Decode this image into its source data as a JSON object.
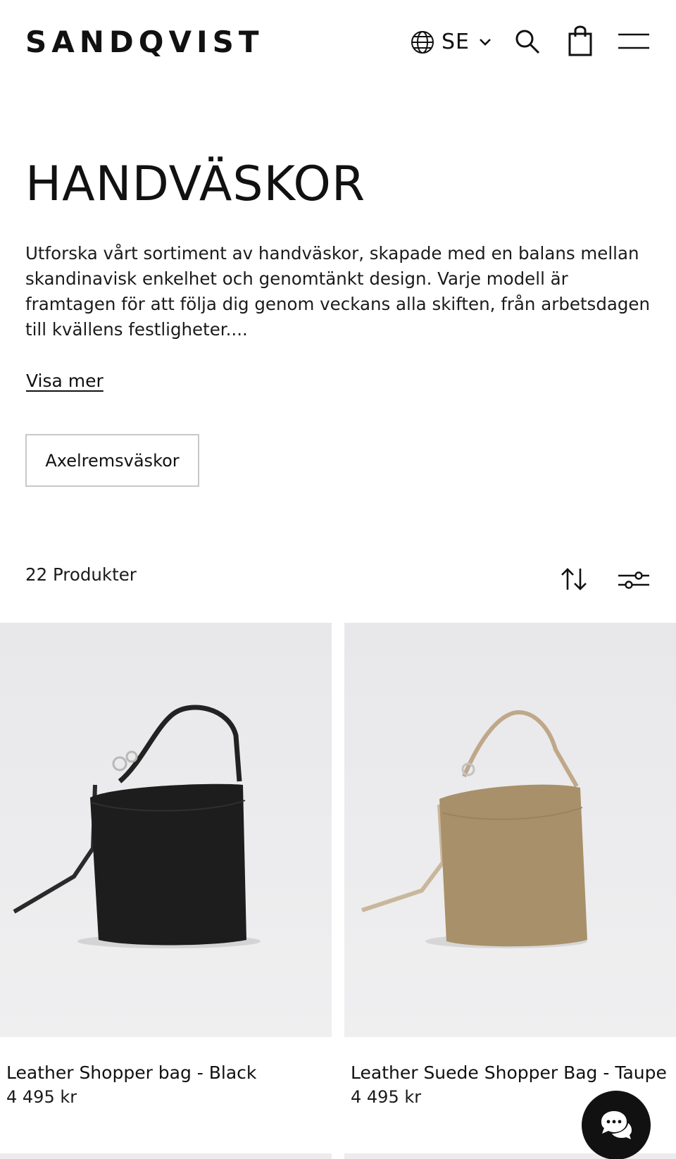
{
  "header": {
    "logo": "SANDQVIST",
    "locale_code": "SE",
    "icons": {
      "locale": "globe-icon",
      "locale_toggle": "chevron-down-icon",
      "search": "search-icon",
      "cart": "shopping-bag-icon",
      "menu": "hamburger-menu-icon"
    }
  },
  "category": {
    "title": "HANDVÄSKOR",
    "description": "Utforska vårt sortiment av handväskor, skapade med en balans mellan skandinavisk enkelhet och genomtänkt design. Varje modell är framtagen för att följa dig genom veckans alla skiften, från arbetsdagen till kvällens festligheter....",
    "more_link": "Visa mer",
    "subcategories": [
      "Axelremsväskor"
    ]
  },
  "listing": {
    "count_label": "22 Produkter",
    "icons": {
      "sort": "sort-arrows-icon",
      "filter": "filter-sliders-icon"
    }
  },
  "products": [
    {
      "name": "Leather Shopper bag - Black",
      "price": "4 495 kr",
      "color": "#1c1c1c"
    },
    {
      "name": "Leather Suede Shopper Bag - Taupe",
      "price": "4 495 kr",
      "color": "#a8906a"
    }
  ],
  "chat": {
    "icon": "chat-bubbles-icon"
  },
  "colors": {
    "text": "#111111",
    "background": "#ffffff",
    "image_bg": "#ececee",
    "chip_border": "#c8c8c8",
    "chat_bg": "#111111"
  }
}
